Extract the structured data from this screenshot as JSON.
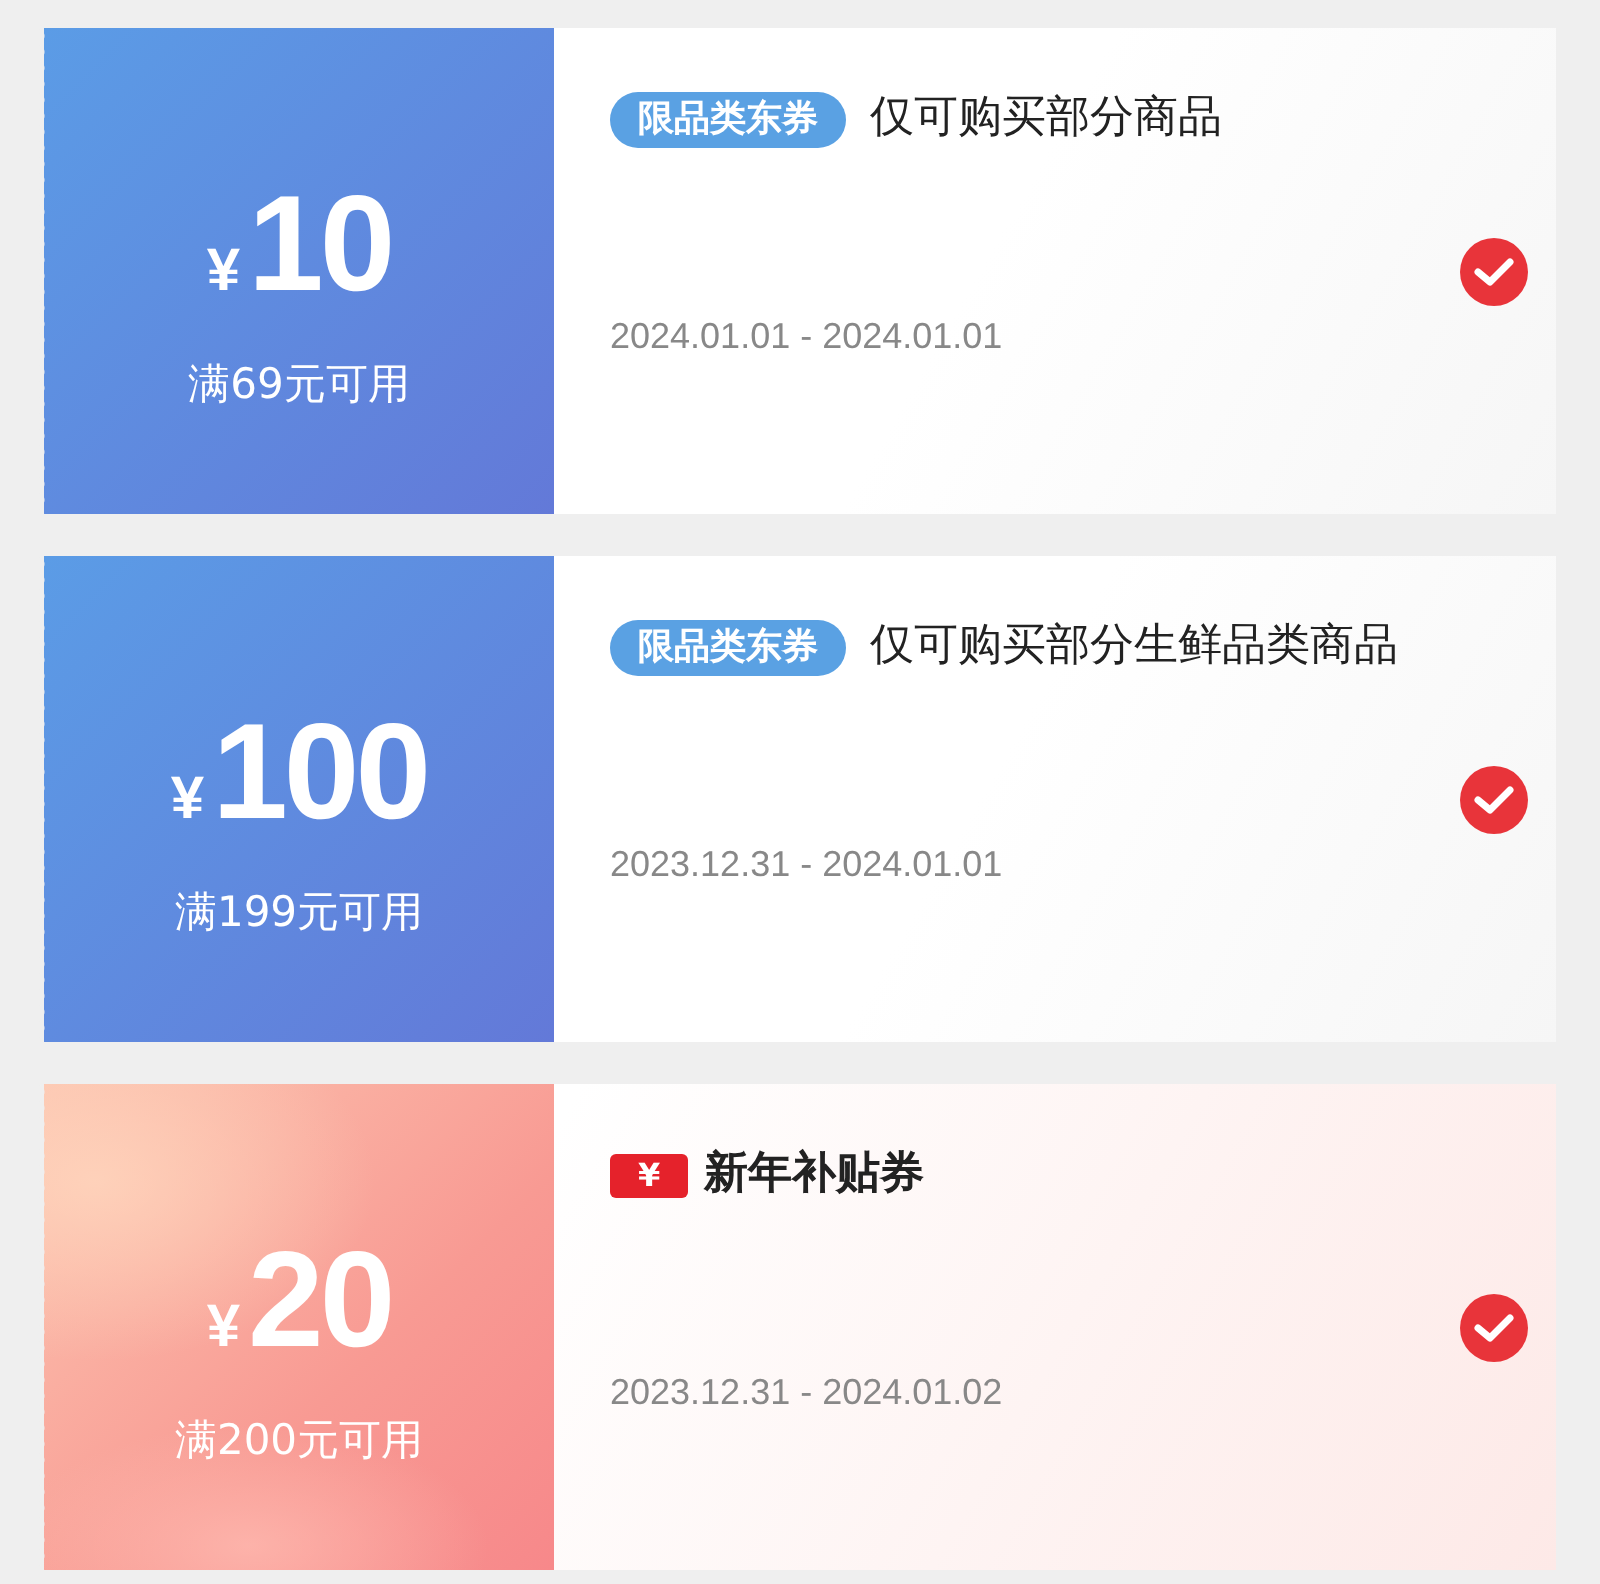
{
  "coupons": [
    {
      "kind": "category",
      "currency": "¥",
      "amount": "10",
      "condition": "满69元可用",
      "tag": "限品类东券",
      "description": "仅可购买部分商品",
      "validity": "2024.01.01 - 2024.01.01",
      "checked": true
    },
    {
      "kind": "category",
      "currency": "¥",
      "amount": "100",
      "condition": "满199元可用",
      "tag": "限品类东券",
      "description": "仅可购买部分生鲜品类商品",
      "validity": "2023.12.31 - 2024.01.01",
      "checked": true
    },
    {
      "kind": "subsidy",
      "currency": "¥",
      "amount": "20",
      "condition": "满200元可用",
      "tag": "¥",
      "description": "新年补贴券",
      "validity": "2023.12.31 - 2024.01.02",
      "checked": true
    }
  ]
}
